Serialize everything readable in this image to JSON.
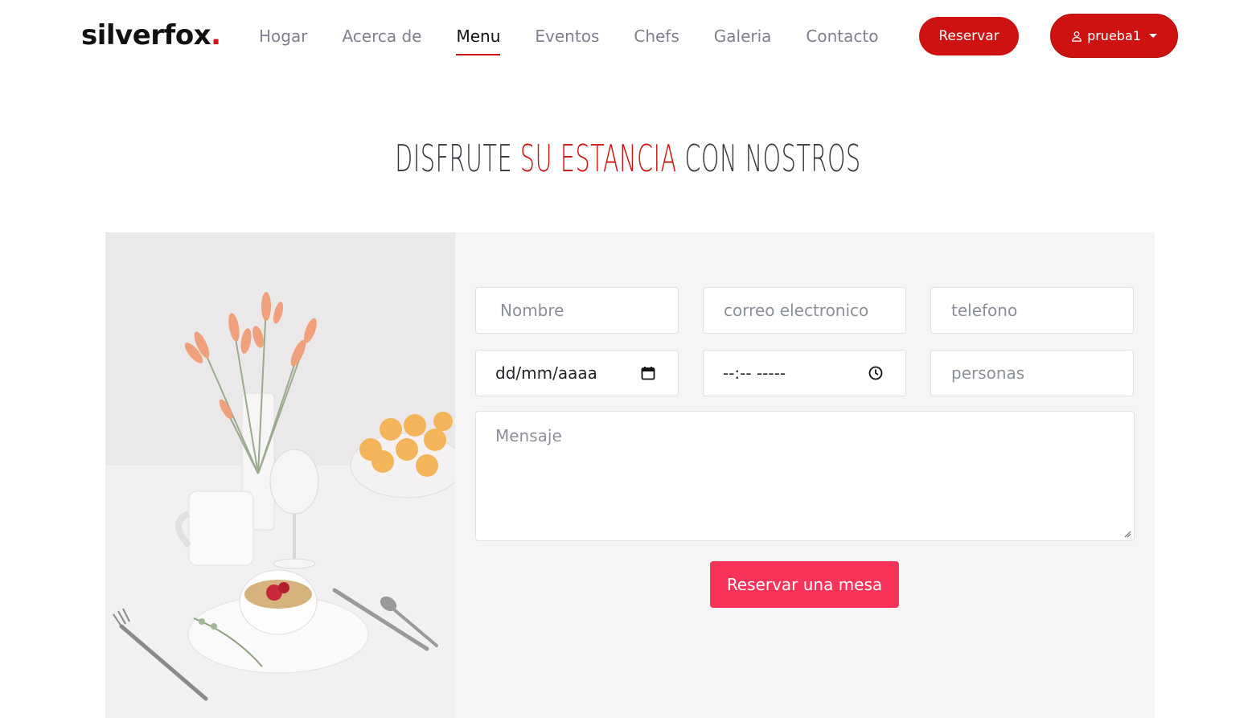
{
  "brand": {
    "name": "silverfox",
    "dot": "."
  },
  "nav": {
    "items": [
      {
        "label": "Hogar"
      },
      {
        "label": "Acerca de"
      },
      {
        "label": "Menu"
      },
      {
        "label": "Eventos"
      },
      {
        "label": "Chefs"
      },
      {
        "label": "Galeria"
      },
      {
        "label": "Contacto"
      }
    ],
    "active": "Menu"
  },
  "header": {
    "reserve_label": "Reservar",
    "user_label": "prueba1",
    "user_icon": "person-icon"
  },
  "section": {
    "title_part1": "DISFRUTE",
    "title_part2": "SU ESTANCIA",
    "title_part3": "CON NOSTROS"
  },
  "form": {
    "name_placeholder": "Nombre",
    "email_placeholder": "correo electronico",
    "phone_placeholder": "telefono",
    "date_value": "dd/mm/aaaa",
    "time_value": "--:-- -----",
    "people_placeholder": "personas",
    "message_placeholder": "Mensaje",
    "submit_label": "Reservar una mesa"
  },
  "colors": {
    "accent": "#ce1212",
    "submit": "#f9325a",
    "card_bg": "#f5f5f5"
  }
}
